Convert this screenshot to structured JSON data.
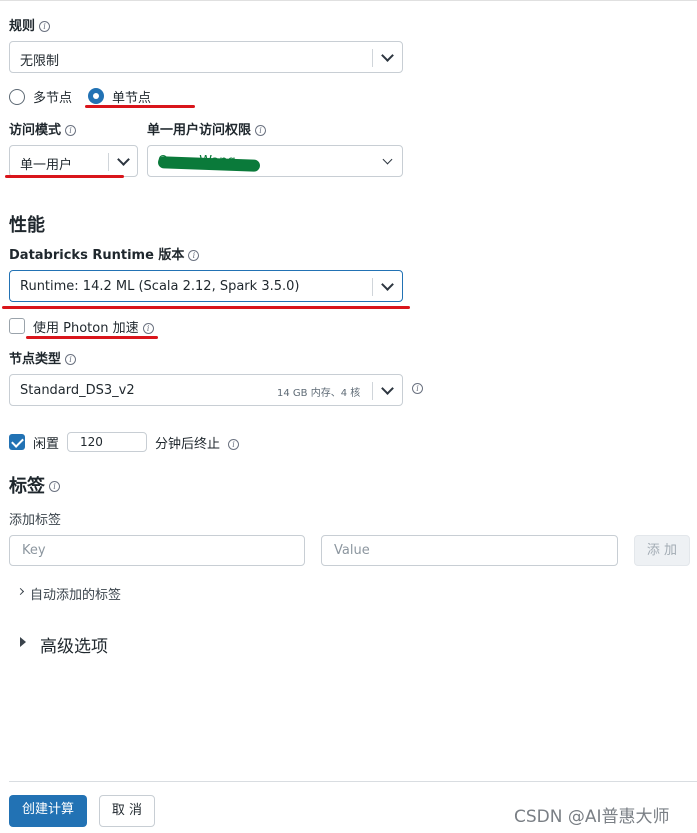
{
  "rules": {
    "label": "规则",
    "value": "无限制"
  },
  "node_mode": {
    "options": [
      {
        "label": "多节点",
        "selected": false
      },
      {
        "label": "单节点",
        "selected": true
      }
    ]
  },
  "access_mode": {
    "label": "访问模式",
    "value": "单一用户"
  },
  "single_user": {
    "label": "单一用户访问权限",
    "value": "Owen Wang"
  },
  "performance": {
    "heading": "性能",
    "runtime_label": "Databricks Runtime 版本",
    "runtime_value": "Runtime: 14.2 ML (Scala 2.12, Spark 3.5.0)",
    "photon_label": "使用 Photon 加速",
    "photon_checked": false,
    "node_type_label": "节点类型",
    "node_type_value": "Standard_DS3_v2",
    "node_type_spec": "14 GB 内存、4 核",
    "idle_label": "闲置",
    "idle_checked": true,
    "idle_minutes": "120",
    "idle_suffix": "分钟后终止"
  },
  "tags": {
    "heading": "标签",
    "add_label": "添加标签",
    "key_placeholder": "Key",
    "value_placeholder": "Value",
    "add_button": "添 加",
    "auto_tags": "自动添加的标签"
  },
  "advanced": {
    "label": "高级选项"
  },
  "footer": {
    "create_button": "创建计算",
    "cancel_button": "取 消"
  },
  "watermark": "CSDN @AI普惠大师",
  "colors": {
    "primary": "#2272b4",
    "annotation_red": "#d9151b",
    "redaction_green": "#0a7a3a"
  }
}
